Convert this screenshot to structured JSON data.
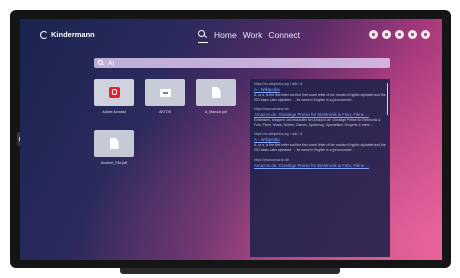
{
  "brand": {
    "name": "Kindermann",
    "logo_icon": "kindermann-logo-icon"
  },
  "nav": {
    "tabs": [
      "Home",
      "Work",
      "Connect"
    ],
    "active": "search",
    "search_icon": "search-icon"
  },
  "top_icons": [
    "power-icon",
    "user-icon",
    "info-icon",
    "notification-icon",
    "settings-icon"
  ],
  "search": {
    "value": "A|"
  },
  "files": [
    {
      "label": "Adobe Acrobat",
      "icon": "acrobat-icon"
    },
    {
      "label": "AKTOS",
      "icon": "app-icon"
    },
    {
      "label": "A_Manual.pdf",
      "icon": "document-icon"
    },
    {
      "label": "Another_File.pdf",
      "icon": "document-icon"
    }
  ],
  "results": [
    {
      "url": "https://en.wikipedia.org › wiki › A",
      "title": "A - Wikipedia",
      "snippet": "A, or a, is the first letter and the first vowel letter of the modern English alphabet and the ISO basic Latin alphabet. ... Its name in English is a (pronounced ..."
    },
    {
      "url": "https://www.amazon.de",
      "title": "Amazon.de: Günstige Preise für Elektronik & Foto, Filme ...",
      "snippet": "Entdecken, shoppen und einkaufen bei Amazon.de: Günstige Preise für Elektronik & Foto, Filme, Musik, Bücher, Games, Spielzeug, Sportartikel, Drogerie & mehr ..."
    },
    {
      "url": "https://en.wikipedia.org › wiki › A",
      "title": "A - Wikipedia",
      "snippet": "A, or a, is the first letter and the first vowel letter of the modern English alphabet and the ISO basic Latin alphabet. ... Its name in English is a (pronounced ..."
    },
    {
      "url": "https://www.amazon.de",
      "title": "Amazon.de: Günstige Preise für Elektronik & Foto, Filme ...",
      "snippet": ""
    }
  ]
}
